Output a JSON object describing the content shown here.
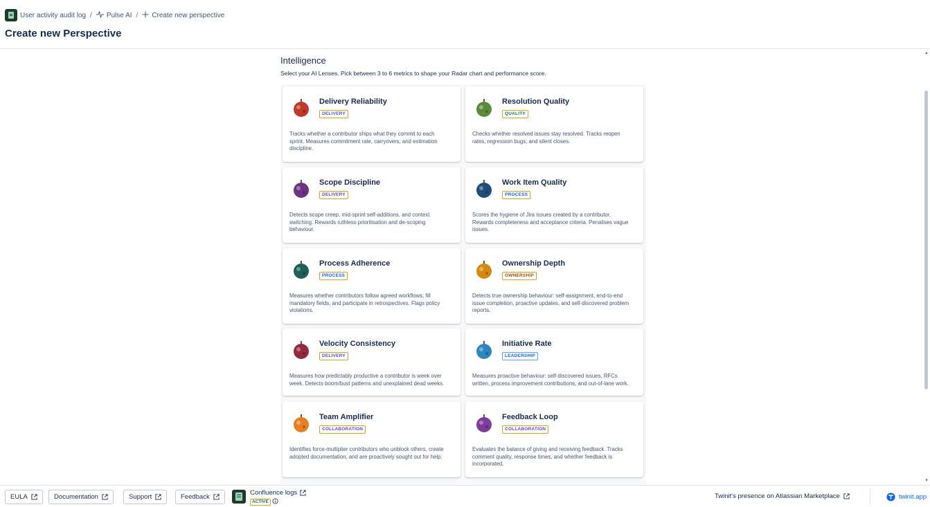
{
  "breadcrumb": {
    "items": [
      {
        "label": "User activity audit log",
        "icon": "app-logo-icon"
      },
      {
        "label": "Pulse AI",
        "icon": "pulse-icon"
      },
      {
        "label": "Create new perspective",
        "icon": "plus-icon"
      }
    ],
    "separator": "/"
  },
  "page": {
    "title": "Create new Perspective"
  },
  "intelligence": {
    "title": "Intelligence",
    "subtitle": "Select your AI Lenses. Pick between 3 to 6 metrics to shape your Radar chart and performance score."
  },
  "lenses": [
    {
      "name": "Delivery Reliability",
      "tag": "DELIVERY",
      "tag_class": "tag-delivery",
      "color": "#c0392b",
      "desc": "Tracks whether a contributor ships what they commit to each sprint. Measures commitment rate, carryovers, and estimation discipline."
    },
    {
      "name": "Resolution Quality",
      "tag": "QUALITY",
      "tag_class": "tag-quality",
      "color": "#5d8a3a",
      "desc": "Checks whether resolved issues stay resolved. Tracks reopen rates, regression bugs, and silent closes."
    },
    {
      "name": "Scope Discipline",
      "tag": "DELIVERY",
      "tag_class": "tag-delivery",
      "color": "#6c3483",
      "desc": "Detects scope creep, mid-sprint self-additions, and context switching. Rewards ruthless prioritisation and de-scoping behaviour."
    },
    {
      "name": "Work Item Quality",
      "tag": "PROCESS",
      "tag_class": "tag-process",
      "color": "#1f4e79",
      "desc": "Scores the hygiene of Jira issues created by a contributor. Rewards completeness and acceptance criteria. Penalises vague issues."
    },
    {
      "name": "Process Adherence",
      "tag": "PROCESS",
      "tag_class": "tag-process",
      "color": "#1e5f5a",
      "desc": "Measures whether contributors follow agreed workflows, fill mandatory fields, and participate in retrospectives. Flags policy violations."
    },
    {
      "name": "Ownership Depth",
      "tag": "OWNERSHIP",
      "tag_class": "tag-ownership",
      "color": "#d68910",
      "desc": "Detects true ownership behaviour: self-assignment, end-to-end issue completion, proactive updates, and self-discovered problem reports."
    },
    {
      "name": "Velocity Consistency",
      "tag": "DELIVERY",
      "tag_class": "tag-delivery",
      "color": "#922b3e",
      "desc": "Measures how predictably productive a contributor is week over week. Detects boom/bust patterns and unexplained dead weeks."
    },
    {
      "name": "Initiative Rate",
      "tag": "LEADERSHIP",
      "tag_class": "tag-leadership",
      "color": "#2e86c1",
      "desc": "Measures proactive behaviour: self-discovered issues, RFCs written, process improvement contributions, and out-of-lane work."
    },
    {
      "name": "Team Amplifier",
      "tag": "COLLABORATION",
      "tag_class": "tag-collab",
      "color": "#e67e22",
      "desc": "Identifies force-multiplier contributors who unblock others, create adopted documentation, and are proactively sought out for help."
    },
    {
      "name": "Feedback Loop",
      "tag": "COLLABORATION",
      "tag_class": "tag-collab",
      "color": "#7d3c98",
      "desc": "Evaluates the balance of giving and receiving feedback. Tracks comment quality, response times, and whether feedback is incorporated."
    }
  ],
  "footer": {
    "eula": "EULA",
    "documentation": "Documentation",
    "support": "Support",
    "feedback": "Feedback",
    "confluence_logs": "Confluence logs",
    "confluence_status": "ACTIVE",
    "marketplace": "Twinit's presence on Atlassian Marketplace",
    "twinit": "twinit.app"
  }
}
